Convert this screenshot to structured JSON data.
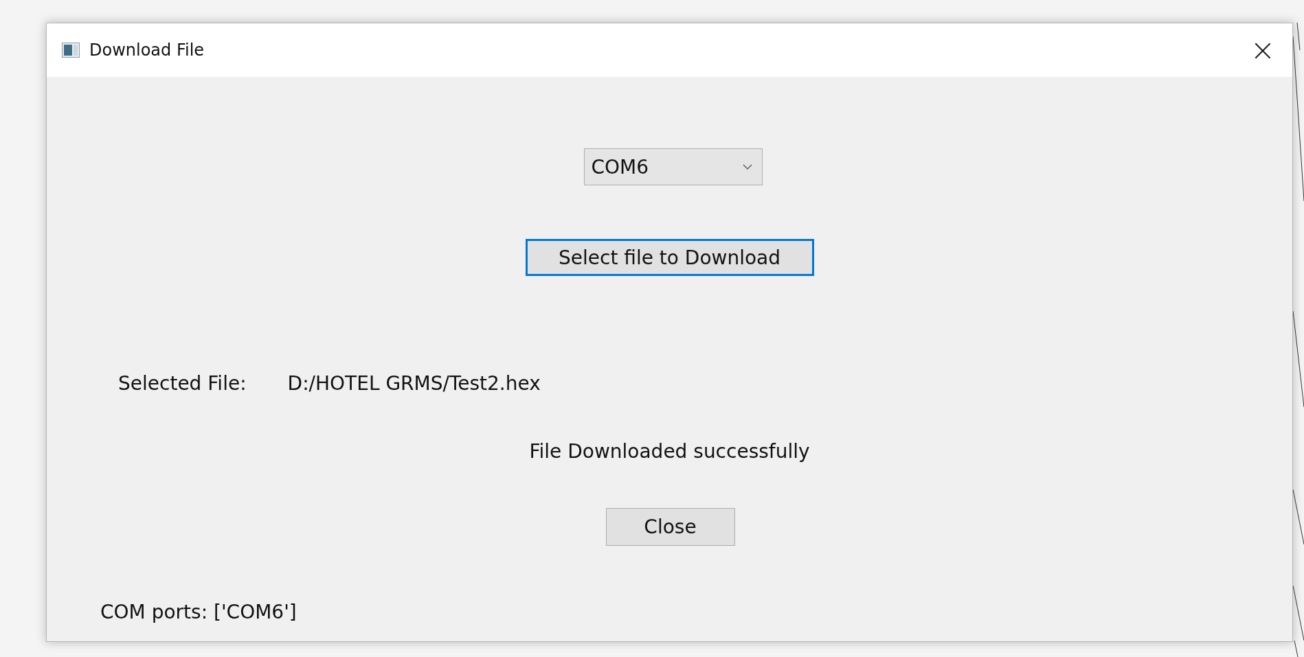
{
  "window": {
    "title": "Download File",
    "close_glyph": "×"
  },
  "port_select": {
    "value": "COM6"
  },
  "select_button": {
    "label": "Select file to Download",
    "focused": true
  },
  "selected_file": {
    "label": "Selected File:",
    "value": "D:/HOTEL GRMS/Test2.hex"
  },
  "status": "File Downloaded successfully",
  "close_button": {
    "label": "Close",
    "focused": false
  },
  "com_ports": "COM ports: ['COM6']"
}
